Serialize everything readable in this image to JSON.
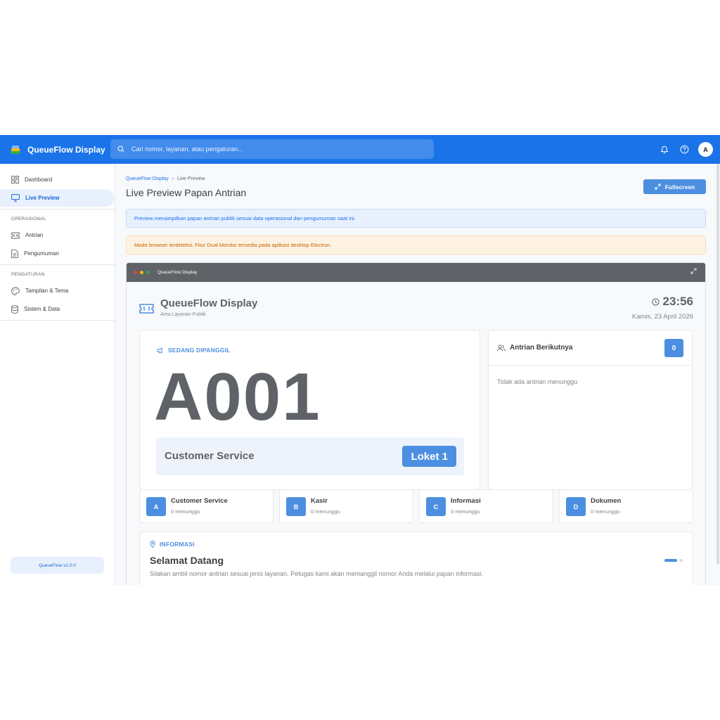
{
  "app": {
    "title": "QueueFlow Display"
  },
  "search": {
    "placeholder": "Cari nomor, layanan, atau pengaturan..."
  },
  "header": {
    "avatar_initial": "A"
  },
  "sidebar": {
    "items": [
      {
        "label": "Dashboard",
        "icon": "dashboard-icon"
      },
      {
        "label": "Live Preview",
        "icon": "monitor-icon",
        "active": true
      }
    ],
    "sections": [
      {
        "title": "OPERASIONAL",
        "items": [
          {
            "label": "Antrian",
            "icon": "ticket-icon"
          },
          {
            "label": "Pengumuman",
            "icon": "document-icon"
          }
        ]
      },
      {
        "title": "PENGATURAN",
        "items": [
          {
            "label": "Tampilan & Tema",
            "icon": "palette-icon"
          },
          {
            "label": "Sistem & Data",
            "icon": "database-icon"
          }
        ]
      }
    ],
    "version": "QueueFlow v1.0.0"
  },
  "main": {
    "breadcrumb": {
      "root": "QueueFlow Display",
      "separator": "›",
      "current": "Live Preview"
    },
    "title": "Live Preview Papan Antrian",
    "fullscreen_label": "Fullscreen",
    "info_alert": "Preview menampilkan papan antrian publik sesuai data operasional dan pengumuman saat ini.",
    "warn_alert": "Mode browser terdeteksi. Fitur Dual Monitor tersedia pada aplikasi desktop Electron."
  },
  "preview": {
    "window_title": "QueueFlow Display",
    "title": "QueueFlow Display",
    "subtitle": "Area Layanan Publik",
    "time": "23:56",
    "date": "Kamis, 23 April 2026",
    "now_serving": {
      "label": "SEDANG DIPANGGIL",
      "number": "A001",
      "service": "Customer Service",
      "counter": "Loket 1"
    },
    "next_queue": {
      "title": "Antrian Berikutnya",
      "count": "0",
      "empty_text": "Tidak ada antrian menunggu"
    },
    "services": [
      {
        "letter": "A",
        "name": "Customer Service",
        "waiting": "0 menunggu"
      },
      {
        "letter": "B",
        "name": "Kasir",
        "waiting": "0 menunggu"
      },
      {
        "letter": "C",
        "name": "Informasi",
        "waiting": "0 menunggu"
      },
      {
        "letter": "D",
        "name": "Dokumen",
        "waiting": "0 menunggu"
      }
    ],
    "info": {
      "label": "INFORMASI",
      "title": "Selamat Datang",
      "text": "Silakan ambil nomor antrian sesuai jenis layanan. Petugas kami akan memanggil nomor Anda melalui papan informasi."
    }
  },
  "colors": {
    "primary": "#1a73e8",
    "accent": "#4c8fe0",
    "warning": "#c26401"
  }
}
